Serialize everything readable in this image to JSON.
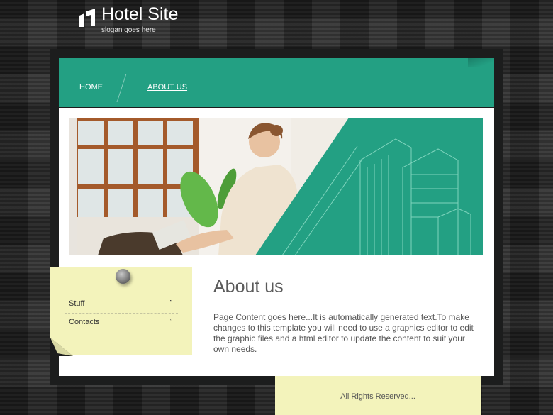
{
  "brand": {
    "title": "Hotel Site",
    "slogan": "slogan goes here"
  },
  "nav": {
    "items": [
      {
        "label": "HOME"
      },
      {
        "label": "ABOUT US",
        "active": true
      }
    ]
  },
  "sidebar": {
    "items": [
      {
        "label": "Stuff",
        "arrow": "”"
      },
      {
        "label": "Contacts",
        "arrow": "”"
      }
    ]
  },
  "main": {
    "heading": "About us",
    "body": "Page Content goes here...It is automatically generated text.To make changes to this template you will need to use a graphics editor to edit the graphic files and a html editor to update the content to suit your own needs."
  },
  "footer": {
    "text": "All Rights Reserved..."
  },
  "colors": {
    "accent_green": "#23a083",
    "note_yellow": "#f3f3bb",
    "frame_dark": "#1c1d1d"
  },
  "icons": {
    "logo": "building-logo-icon",
    "pin": "push-pin-icon"
  }
}
